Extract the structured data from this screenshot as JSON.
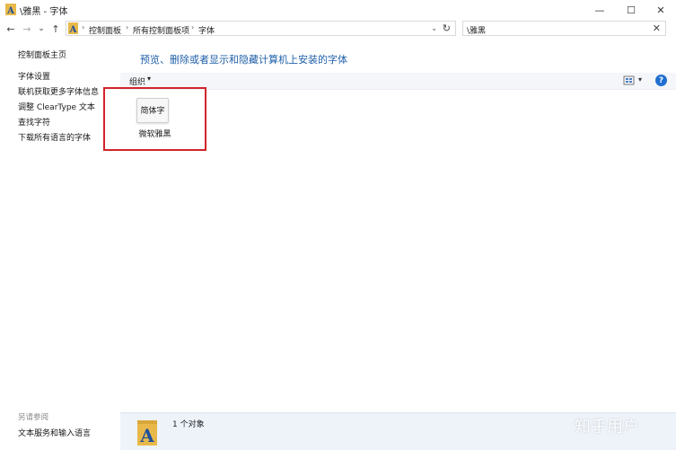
{
  "window": {
    "title": "\\雅黑 - 字体",
    "controls": {
      "minimize": "—",
      "maximize": "☐",
      "close": "✕"
    }
  },
  "navigation": {
    "back": "←",
    "forward": "→",
    "recent": "⌄",
    "up": "↑"
  },
  "address_bar": {
    "breadcrumbs": [
      "控制面板",
      "所有控制面板项",
      "字体"
    ],
    "separator": "›",
    "dropdown": "⌄",
    "refresh": "↻"
  },
  "search": {
    "value": "\\雅黑",
    "clear": "✕"
  },
  "sidebar": {
    "home": "控制面板主页",
    "links": [
      "字体设置",
      "联机获取更多字体信息",
      "调整 ClearType 文本",
      "查找字符",
      "下载所有语言的字体"
    ],
    "see_also_heading": "另请参阅",
    "see_also_links": [
      "文本服务和输入语言"
    ]
  },
  "main": {
    "heading": "预览、删除或者显示和隐藏计算机上安装的字体",
    "toolbar": {
      "organize": "组织",
      "organize_arrow": "▾",
      "view_arrow": "▾",
      "help": "?"
    },
    "fonts": [
      {
        "preview": "简体字",
        "name": "微软雅黑"
      }
    ]
  },
  "status": {
    "count_text": "1 个对象"
  },
  "watermark": "知乎用户",
  "colors": {
    "accent_blue": "#1f5fa8",
    "selection_border": "#d2232a",
    "status_bg": "#eef3fa",
    "folder_yellow": "#e8b94a"
  }
}
